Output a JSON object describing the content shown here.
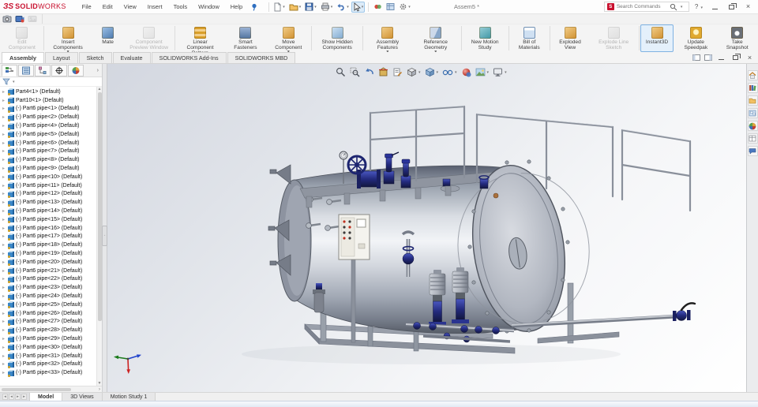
{
  "app": {
    "brand_prefix": "ЗS",
    "brand_solid": "SOLID",
    "brand_works": "WORKS",
    "document_title": "Assem5 *"
  },
  "menubar": {
    "items": [
      "File",
      "Edit",
      "View",
      "Insert",
      "Tools",
      "Window",
      "Help"
    ]
  },
  "quick_toolbar": {
    "icons": [
      "new-document-icon",
      "open-icon",
      "save-icon",
      "print-icon",
      "undo-icon",
      "select-cursor-icon",
      "appearance-icon",
      "display-settings-icon",
      "options-gear-icon"
    ]
  },
  "search": {
    "placeholder": "Search Commands"
  },
  "capture_toolbar": {
    "icons": [
      "screen-capture-icon",
      "record-video-icon",
      "image-capture-icon"
    ]
  },
  "ribbon": {
    "buttons": [
      {
        "name": "edit-component-button",
        "label": "Edit Component",
        "icon": "ic-edit",
        "disabled": true
      },
      {
        "sep": true
      },
      {
        "name": "insert-components-button",
        "label": "Insert Components",
        "dropdown": true
      },
      {
        "name": "mate-button",
        "label": "Mate",
        "icon": "ic-mate"
      },
      {
        "name": "component-preview-window-button",
        "label": "Component Preview Window",
        "icon": "ic-preview",
        "disabled": true
      },
      {
        "sep": true
      },
      {
        "name": "linear-component-pattern-button",
        "label": "Linear Component Pattern",
        "icon": "ic-pattern",
        "dropdown": true
      },
      {
        "name": "smart-fasteners-button",
        "label": "Smart Fasteners",
        "icon": "ic-fasteners"
      },
      {
        "name": "move-component-button",
        "label": "Move Component",
        "dropdown": true
      },
      {
        "sep": true
      },
      {
        "name": "show-hidden-components-button",
        "label": "Show Hidden Components",
        "icon": "ic-hidden"
      },
      {
        "sep": true
      },
      {
        "name": "assembly-features-button",
        "label": "Assembly Features",
        "dropdown": true
      },
      {
        "name": "reference-geometry-button",
        "label": "Reference Geometry",
        "icon": "ic-refgeo",
        "dropdown": true
      },
      {
        "sep": true
      },
      {
        "name": "new-motion-study-button",
        "label": "New Motion Study",
        "icon": "ic-motion"
      },
      {
        "sep": true
      },
      {
        "name": "bill-of-materials-button",
        "label": "Bill of Materials",
        "icon": "ic-bom"
      },
      {
        "sep": true
      },
      {
        "name": "exploded-view-button",
        "label": "Exploded View"
      },
      {
        "name": "explode-line-sketch-button",
        "label": "Explode Line Sketch",
        "icon": "ic-explline",
        "disabled": true
      },
      {
        "sep": true
      },
      {
        "name": "instant3d-button",
        "label": "Instant3D",
        "active": true
      },
      {
        "name": "update-speedpak-button",
        "label": "Update Speedpak",
        "icon": "ic-speedpak"
      },
      {
        "name": "take-snapshot-button",
        "label": "Take Snapshot",
        "icon": "ic-snapshot"
      }
    ],
    "tabs": [
      {
        "name": "tab-assembly",
        "label": "Assembly",
        "active": true
      },
      {
        "name": "tab-layout",
        "label": "Layout"
      },
      {
        "name": "tab-sketch",
        "label": "Sketch"
      },
      {
        "name": "tab-evaluate",
        "label": "Evaluate"
      },
      {
        "name": "tab-solidworks-add-ins",
        "label": "SOLIDWORKS Add-Ins"
      },
      {
        "name": "tab-solidworks-mbd",
        "label": "SOLIDWORKS MBD"
      }
    ]
  },
  "feature_tree": {
    "panel_tabs": [
      "featuremanager-design-tree-icon",
      "propertymanager-icon",
      "configurationmanager-icon",
      "dimxpertmanager-icon",
      "displaymanager-icon"
    ],
    "items": [
      "Part4<1> (Default)",
      "Part10<1> (Default)",
      "(-) Part6 pipe<1> (Default)",
      "(-) Part6 pipe<2> (Default)",
      "(-) Part6 pipe<4> (Default)",
      "(-) Part6 pipe<5> (Default)",
      "(-) Part6 pipe<6> (Default)",
      "(-) Part6 pipe<7> (Default)",
      "(-) Part6 pipe<8> (Default)",
      "(-) Part6 pipe<9> (Default)",
      "(-) Part6 pipe<10> (Default)",
      "(-) Part6 pipe<11> (Default)",
      "(-) Part6 pipe<12> (Default)",
      "(-) Part6 pipe<13> (Default)",
      "(-) Part6 pipe<14> (Default)",
      "(-) Part6 pipe<15> (Default)",
      "(-) Part6 pipe<16> (Default)",
      "(-) Part6 pipe<17> (Default)",
      "(-) Part6 pipe<18> (Default)",
      "(-) Part6 pipe<19> (Default)",
      "(-) Part6 pipe<20> (Default)",
      "(-) Part6 pipe<21> (Default)",
      "(-) Part6 pipe<22> (Default)",
      "(-) Part6 pipe<23> (Default)",
      "(-) Part6 pipe<24> (Default)",
      "(-) Part6 pipe<25> (Default)",
      "(-) Part6 pipe<26> (Default)",
      "(-) Part6 pipe<27> (Default)",
      "(-) Part6 pipe<28> (Default)",
      "(-) Part6 pipe<29> (Default)",
      "(-) Part6 pipe<30> (Default)",
      "(-) Part6 pipe<31> (Default)",
      "(-) Part6 pipe<32> (Default)",
      "(-) Part6 pipe<33> (Default)"
    ]
  },
  "headsup_toolbar": {
    "icons": [
      "zoom-to-fit-icon",
      "zoom-to-area-icon",
      "previous-view-icon",
      "section-view-icon",
      "dynamic-annotation-views-icon",
      "view-orientation-icon",
      "display-style-icon",
      "hide-show-items-icon",
      "edit-appearance-icon",
      "apply-scene-icon",
      "view-settings-icon"
    ]
  },
  "task_pane": {
    "icons": [
      "solidworks-resources-icon",
      "design-library-icon",
      "file-explorer-icon",
      "view-palette-icon",
      "appearances-scenes-icon",
      "custom-properties-icon",
      "solidworks-forum-icon"
    ]
  },
  "document_tabs": {
    "tabs": [
      {
        "name": "tab-model",
        "label": "Model",
        "active": true
      },
      {
        "name": "tab-3d-views",
        "label": "3D Views"
      },
      {
        "name": "tab-motion-study-1",
        "label": "Motion Study 1"
      }
    ]
  },
  "colors": {
    "brand_red": "#c8102e",
    "valve_navy": "#232a7d",
    "steel_gray": "#9aa0ab",
    "selection_blue": "#e4f0fb"
  }
}
